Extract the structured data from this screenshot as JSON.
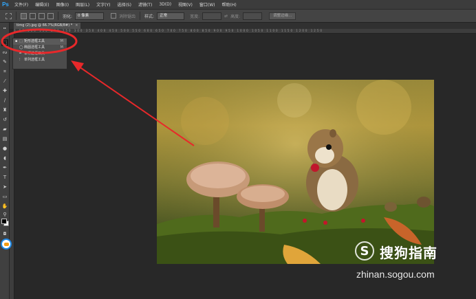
{
  "app": {
    "logo": "Ps"
  },
  "menu": [
    "文件(F)",
    "编辑(E)",
    "图像(I)",
    "图层(L)",
    "文字(Y)",
    "选择(S)",
    "滤镜(T)",
    "3D(D)",
    "视图(V)",
    "窗口(W)",
    "帮助(H)"
  ],
  "options": {
    "feather_label": "羽化:",
    "feather_value": "0 像素",
    "antialias_label": "消除锯齿",
    "style_label": "样式:",
    "style_value": "正常",
    "width_label": "宽度:",
    "height_label": "高度:",
    "refine_button": "调整边缘..."
  },
  "document": {
    "tab_title": "timg (2).jpg @ 66.7%(RGB/8#) *",
    "close_glyph": "×"
  },
  "ruler_ticks": "0 50 100 150 200 250 300 350 400 450 500 550 600 650 700 750 800 850 900 950 1000 1050 1100 1150 1200 1250",
  "flyout": {
    "items": [
      {
        "label": "矩形选框工具",
        "key": "M",
        "active": true
      },
      {
        "label": "椭圆选框工具",
        "key": "M",
        "active": false
      },
      {
        "label": "单行选框工具",
        "key": "",
        "active": false
      },
      {
        "label": "单列选框工具",
        "key": "",
        "active": false
      }
    ]
  },
  "tools": [
    "marquee-icon",
    "lasso-icon",
    "quick-select-icon",
    "crop-icon",
    "eyedropper-icon",
    "healing-icon",
    "brush-icon",
    "stamp-icon",
    "history-brush-icon",
    "eraser-icon",
    "gradient-icon",
    "blur-icon",
    "dodge-icon",
    "pen-icon",
    "type-icon",
    "path-select-icon",
    "shape-icon",
    "hand-icon",
    "zoom-icon"
  ],
  "watermark": {
    "logo_letter": "S",
    "text": "搜狗指南",
    "url": "zhinan.sogou.com"
  },
  "colors": {
    "annotation_red": "#e8282a",
    "ps_blue": "#31a8ff"
  }
}
